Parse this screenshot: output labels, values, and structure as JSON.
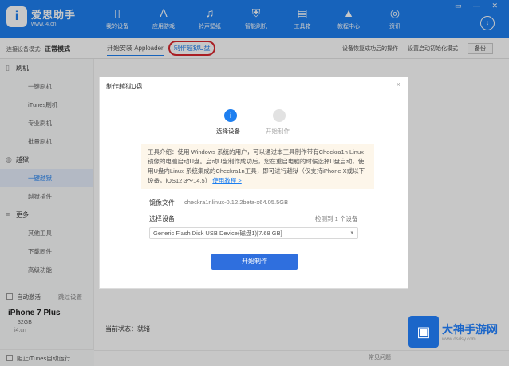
{
  "app": {
    "logo_mark": "i",
    "name": "爱思助手",
    "url": "www.i4.cn",
    "nav": [
      {
        "label": "我的设备",
        "icon": "phone-icon",
        "glyph": "▯"
      },
      {
        "label": "应用游戏",
        "icon": "appstore-icon",
        "glyph": "A"
      },
      {
        "label": "铃声壁纸",
        "icon": "music-icon",
        "glyph": "♫"
      },
      {
        "label": "智能刷机",
        "icon": "shield-icon",
        "glyph": "⛨"
      },
      {
        "label": "工具箱",
        "icon": "toolbox-icon",
        "glyph": "▤"
      },
      {
        "label": "教程中心",
        "icon": "graduation-cap-icon",
        "glyph": "▲"
      },
      {
        "label": "资讯",
        "icon": "compass-icon",
        "glyph": "◎"
      }
    ],
    "window_controls": "▭ — ✕",
    "download_glyph": "↓"
  },
  "modebar": {
    "conn_label": "连接设备模式:",
    "mode": "正常模式",
    "tabs": [
      "开始安装 Apploader",
      "制作越狱U盘"
    ],
    "right_items": [
      "设备恢复成功后的操作",
      "设置启动初始化模式"
    ],
    "backup": "备份"
  },
  "sidebar": {
    "groups": [
      {
        "label": "刷机",
        "items": [
          "一键刷机",
          "iTunes刷机",
          "专业刷机",
          "批量刷机"
        ]
      },
      {
        "label": "越狱",
        "items": [
          "一键越狱",
          "越狱插件"
        ]
      },
      {
        "label": "更多",
        "items": [
          "其他工具",
          "下载固件",
          "高级功能"
        ]
      }
    ],
    "auto_activate": "自动激活",
    "auto_link": "跳过设置",
    "device_name": "iPhone 7 Plus",
    "device_capacity": "32GB",
    "device_user": "i4.cn"
  },
  "main": {
    "status_label": "当前状态：",
    "status_value": "就绪",
    "footer_cb": "阻止iTunes自动运行",
    "footer_right": "常见问题"
  },
  "dialog": {
    "title": "制作越狱U盘",
    "close": "×",
    "step1_num": "i",
    "step1_label": "选择设备",
    "step2_label": "开始制作",
    "notice_text": "工具介绍：使用 Windows 系统的用户，可以通过本工具制作带有Checkra1n Linux 镜像的电脑启动U盘。启动U盘制作成功后，您在重启电脑的时候选择U盘启动，使用U盘内Linux 系统集成的Checkra1n工具，即可进行越狱（仅支持iPhone X或以下设备，iOS12.3～14.5）",
    "notice_link": "使用教程 >",
    "image_label": "镜像文件",
    "image_value": "checkra1nlinux-0.12.2beta-x64.05.5GB",
    "device_label": "选择设备",
    "device_detected": "检测到 1 个设备",
    "device_option": "Generic Flash Disk USB Device(磁盘1)[7.68 GB]",
    "start_button": "开始制作"
  },
  "watermark": {
    "name": "大神手游网",
    "url": "www.dsdsy.com"
  }
}
